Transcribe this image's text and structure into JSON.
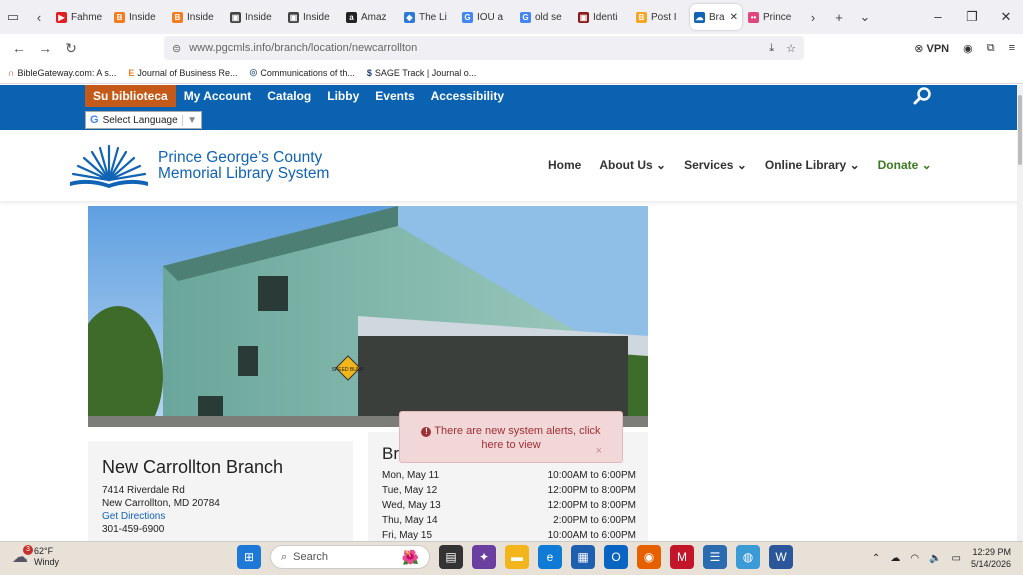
{
  "browser": {
    "tabs": [
      {
        "label": "Fahme",
        "color": "#e02020",
        "glyph": "▶"
      },
      {
        "label": "Inside",
        "color": "#f57c1f",
        "glyph": "B"
      },
      {
        "label": "Inside",
        "color": "#f57c1f",
        "glyph": "B"
      },
      {
        "label": "Inside",
        "color": "#444444",
        "glyph": "▣"
      },
      {
        "label": "Inside",
        "color": "#444444",
        "glyph": "▣"
      },
      {
        "label": "Amaz",
        "color": "#222222",
        "glyph": "a"
      },
      {
        "label": "The Li",
        "color": "#2a7bd8",
        "glyph": "◆"
      },
      {
        "label": "IOU a",
        "color": "#4285f4",
        "glyph": "G"
      },
      {
        "label": "old se",
        "color": "#4285f4",
        "glyph": "G"
      },
      {
        "label": "Identi",
        "color": "#8b1a1a",
        "glyph": "▣"
      },
      {
        "label": "Post I",
        "color": "#f5a623",
        "glyph": "B"
      },
      {
        "label": "Bra",
        "color": "#1063b5",
        "glyph": "☁",
        "active": true
      },
      {
        "label": "Prince",
        "color": "#e0457b",
        "glyph": "••"
      }
    ],
    "url": "www.pgcmls.info/branch/location/newcarrollton",
    "vpn_label": "VPN",
    "bookmarks": [
      {
        "label": "BibleGateway.com: A s...",
        "glyph": "∩",
        "color": "#c4302b"
      },
      {
        "label": "Journal of Business Re...",
        "glyph": "E",
        "color": "#f57c1f"
      },
      {
        "label": "Communications of th...",
        "glyph": "◎",
        "color": "#5a7aa5"
      },
      {
        "label": "SAGE Track | Journal o...",
        "glyph": "$",
        "color": "#1a3d7a"
      }
    ]
  },
  "site": {
    "top_nav": [
      "Su biblioteca",
      "My Account",
      "Catalog",
      "Libby",
      "Events",
      "Accessibility"
    ],
    "language_label": "Select Language",
    "logo_line1": "Prince George’s County",
    "logo_line2": "Memorial Library System",
    "main_nav": [
      {
        "label": "Home",
        "caret": ""
      },
      {
        "label": "About Us",
        "caret": "⌄"
      },
      {
        "label": "Services",
        "caret": "⌄"
      },
      {
        "label": "Online Library",
        "caret": "⌄"
      },
      {
        "label": "Donate",
        "caret": "⌄"
      }
    ],
    "hero_sign": "SPEED BUMP"
  },
  "branch": {
    "name": "New Carrollton Branch",
    "address1": "7414 Riverdale Rd",
    "address2": "New Carrollton, MD 20784",
    "directions": "Get Directions",
    "phone": "301-459-6900",
    "extra": "Br"
  },
  "hours": {
    "title": "Br",
    "rows": [
      {
        "day": "Mon, May 11",
        "time": "10:00AM to 6:00PM"
      },
      {
        "day": "Tue, May 12",
        "time": "12:00PM to 8:00PM"
      },
      {
        "day": "Wed, May 13",
        "time": "12:00PM to 8:00PM"
      },
      {
        "day": "Thu, May 14",
        "time": "2:00PM to 6:00PM"
      },
      {
        "day": "Fri, May 15",
        "time": "10:00AM to 6:00PM"
      }
    ]
  },
  "alert": {
    "text": "There are new system alerts, click here to view",
    "close": "×"
  },
  "taskbar": {
    "temperature": "62°F",
    "condition": "Windy",
    "weather_badge": "3",
    "search_placeholder": "Search",
    "time": "12:29 PM",
    "date": "5/14/2026"
  }
}
